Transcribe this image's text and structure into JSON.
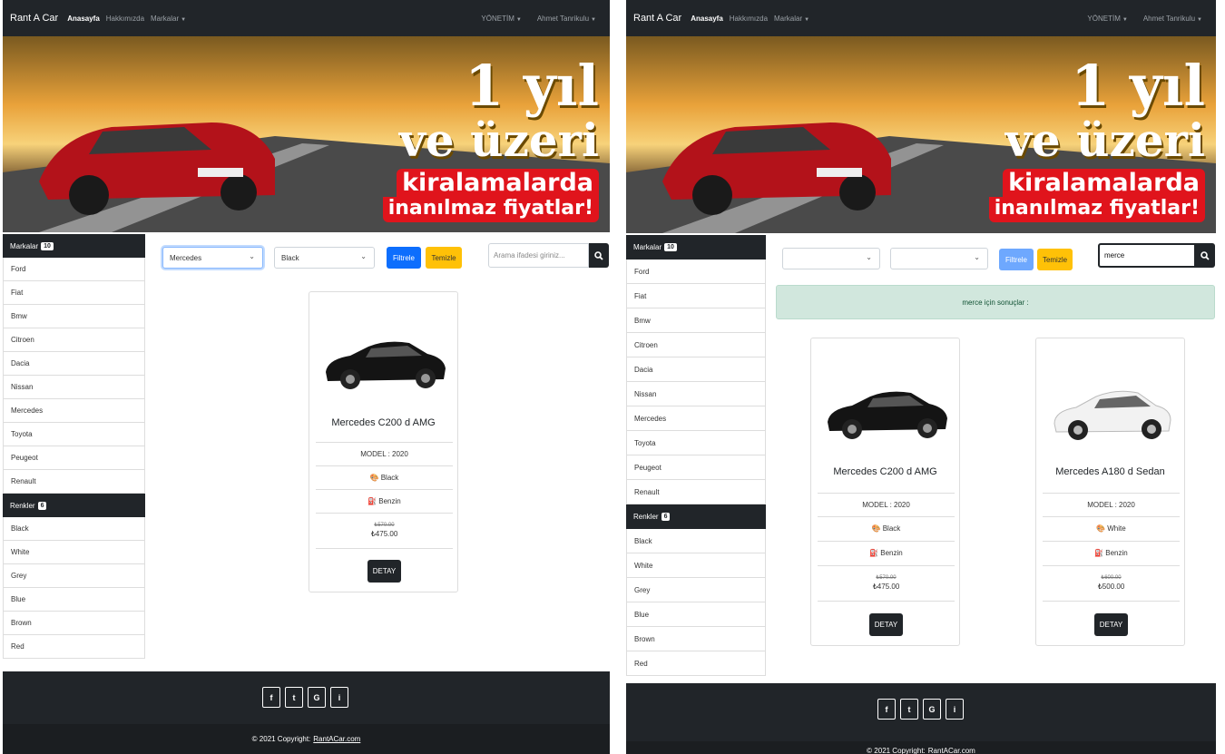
{
  "nav": {
    "brand": "Rant A Car",
    "home": "Anasayfa",
    "about": "Hakkımızda",
    "brands": "Markalar",
    "admin": "YÖNETİM",
    "user": "Ahmet Tanrikulu"
  },
  "banner": {
    "line1": "1 yıl",
    "line2": "ve üzeri",
    "line3": "kiralamalarda",
    "line4": "inanılmaz fiyatlar!"
  },
  "sidebar": {
    "brands_title": "Markalar",
    "brands_count": "10",
    "brands": [
      "Ford",
      "Fiat",
      "Bmw",
      "Citroen",
      "Dacia",
      "Nissan",
      "Mercedes",
      "Toyota",
      "Peugeot",
      "Renault"
    ],
    "colors_title": "Renkler",
    "colors_count": "6",
    "colors": [
      "Black",
      "White",
      "Grey",
      "Blue",
      "Brown",
      "Red"
    ]
  },
  "filters": {
    "filter_button": "Filtrele",
    "clear_button": "Temizle",
    "search_placeholder": "Arama ifadesi giriniz..."
  },
  "left": {
    "brand_selected": "Mercedes",
    "color_selected": "Black",
    "cards": [
      {
        "title": "Mercedes C200 d AMG",
        "model": "MODEL : 2020",
        "color": "Black",
        "fuel": "Benzin",
        "old_price": "₺570.00",
        "price": "₺475.00",
        "button": "DETAY"
      }
    ]
  },
  "right": {
    "search_value": "merce",
    "result_message": "merce için sonuçlar :",
    "cards": [
      {
        "title": "Mercedes C200 d AMG",
        "model": "MODEL : 2020",
        "color": "Black",
        "fuel": "Benzin",
        "old_price": "₺570.00",
        "price": "₺475.00",
        "button": "DETAY"
      },
      {
        "title": "Mercedes A180 d Sedan",
        "model": "MODEL : 2020",
        "color": "White",
        "fuel": "Benzin",
        "old_price": "₺600.00",
        "price": "₺500.00",
        "button": "DETAY"
      }
    ]
  },
  "footer": {
    "social": [
      "f",
      "t",
      "G",
      "i"
    ],
    "copyright": "© 2021 Copyright:",
    "site": "RantACar.com"
  },
  "colors": {
    "dark": "#212529",
    "primary": "#0d6efd",
    "warning": "#ffc107",
    "success_bg": "#d1e7dd"
  }
}
